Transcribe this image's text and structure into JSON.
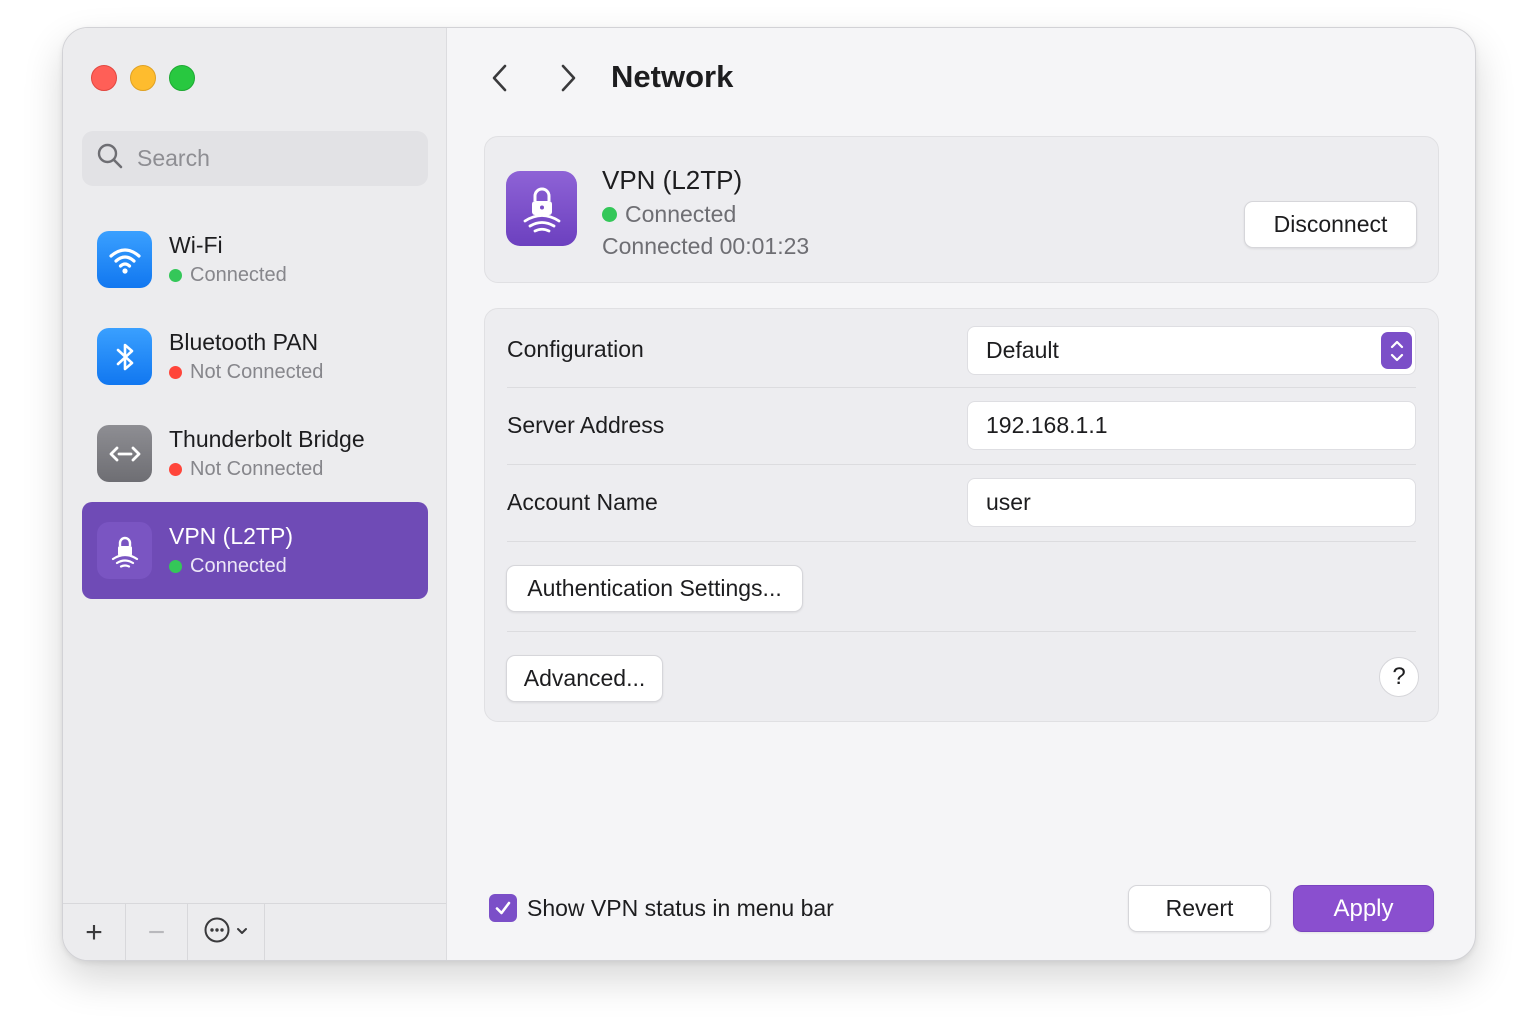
{
  "window": {
    "title": "Network"
  },
  "search": {
    "placeholder": "Search"
  },
  "sidebar": {
    "items": [
      {
        "label": "Wi-Fi",
        "status": "Connected",
        "status_color": "#34c759",
        "icon": "wifi-icon"
      },
      {
        "label": "Bluetooth PAN",
        "status": "Not Connected",
        "status_color": "#ff453a",
        "icon": "bluetooth-icon"
      },
      {
        "label": "Thunderbolt Bridge",
        "status": "Not Connected",
        "status_color": "#ff453a",
        "icon": "thunderbolt-bridge-icon"
      },
      {
        "label": "VPN (L2TP)",
        "status": "Connected",
        "status_color": "#34c759",
        "icon": "vpn-lock-icon",
        "selected": true
      }
    ],
    "footer": {
      "add": "+",
      "remove": "−",
      "more_icon": "ellipsis-circle-icon"
    }
  },
  "header": {
    "service_name": "VPN (L2TP)",
    "status": "Connected",
    "duration": "Connected 00:01:23",
    "disconnect_label": "Disconnect"
  },
  "settings": {
    "configuration_label": "Configuration",
    "configuration_value": "Default",
    "server_label": "Server Address",
    "server_value": "192.168.1.1",
    "account_label": "Account Name",
    "account_value": "user",
    "auth_button": "Authentication Settings...",
    "advanced_button": "Advanced...",
    "help": "?"
  },
  "footer": {
    "show_status_label": "Show VPN status in menu bar",
    "show_status_checked": true,
    "revert_label": "Revert",
    "apply_label": "Apply"
  },
  "colors": {
    "accent": "#7b4fc8",
    "selected_sidebar": "#6f4bb6",
    "connected": "#34c759",
    "not_connected": "#ff453a"
  }
}
